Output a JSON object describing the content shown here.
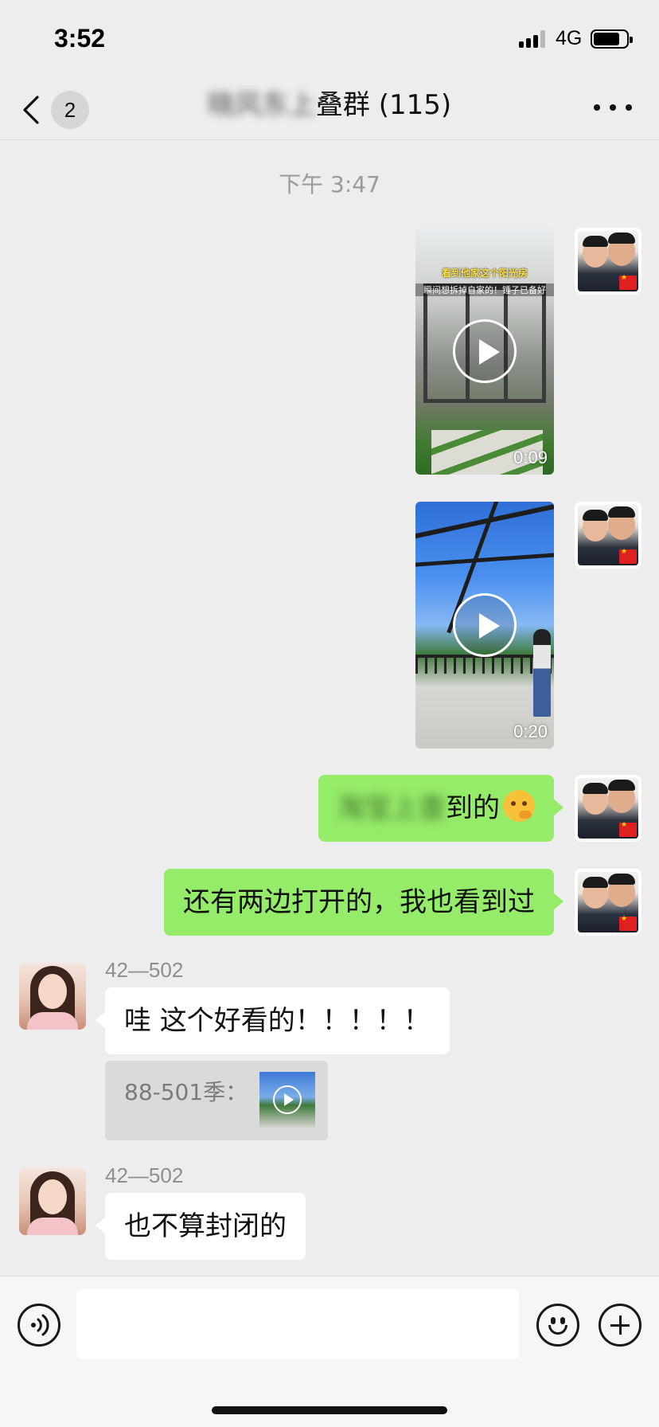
{
  "status_bar": {
    "time": "3:52",
    "network": "4G",
    "battery_level": 0.8
  },
  "nav": {
    "back_count": "2",
    "title_blurred": "晓风东上",
    "title_visible": "叠群",
    "member_count": "(115)"
  },
  "timestamp": "下午 3:47",
  "messages": [
    {
      "type": "video",
      "direction": "outgoing",
      "caption_line1": "看到他家这个阳光房",
      "caption_line2": "瞬间想拆掉自家的！锤子已备好",
      "duration": "0:09"
    },
    {
      "type": "video",
      "direction": "outgoing",
      "duration": "0:20"
    },
    {
      "type": "text",
      "direction": "outgoing",
      "blurred_part": "淘宝上查",
      "text": "到的"
    },
    {
      "type": "text",
      "direction": "outgoing",
      "text": "还有两边打开的，我也看到过"
    },
    {
      "type": "text",
      "direction": "incoming",
      "sender": "42—502",
      "text": "哇 这个好看的！！！！！",
      "quote": {
        "label": "88-501季："
      }
    },
    {
      "type": "text",
      "direction": "incoming",
      "sender": "42—502",
      "text": "也不算封闭的"
    }
  ],
  "input_bar": {
    "placeholder": ""
  },
  "colors": {
    "background": "#ededed",
    "outgoing_bubble": "#95ec69",
    "incoming_bubble": "#ffffff",
    "timestamp_text": "#9b9b9b"
  },
  "icons": {
    "back": "chevron-left-icon",
    "more": "ellipsis-icon",
    "voice": "voice-icon",
    "emoji": "emoji-face-icon",
    "plus": "plus-icon",
    "play": "play-icon",
    "reaction_emoji": "thinking-face-emoji"
  }
}
